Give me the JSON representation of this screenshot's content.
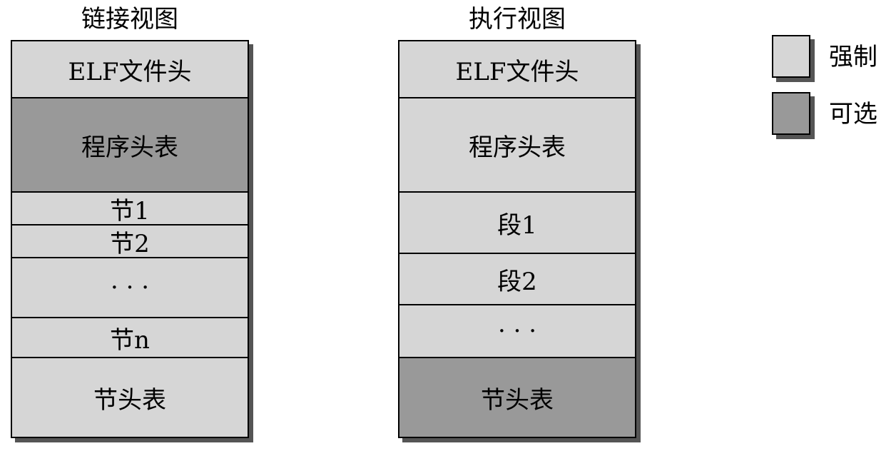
{
  "link_view": {
    "title": "链接视图",
    "segments": [
      "ELF文件头",
      "程序头表",
      "节1",
      "节2",
      "· · ·",
      "节n",
      "节头表"
    ]
  },
  "exec_view": {
    "title": "执行视图",
    "segments": [
      "ELF文件头",
      "程序头表",
      "段1",
      "段2",
      "· · ·",
      "节头表"
    ]
  },
  "legend": {
    "mandatory_label": "强制",
    "optional_label": "可选"
  },
  "colors": {
    "mandatory": "#d6d6d6",
    "optional": "#999999"
  }
}
